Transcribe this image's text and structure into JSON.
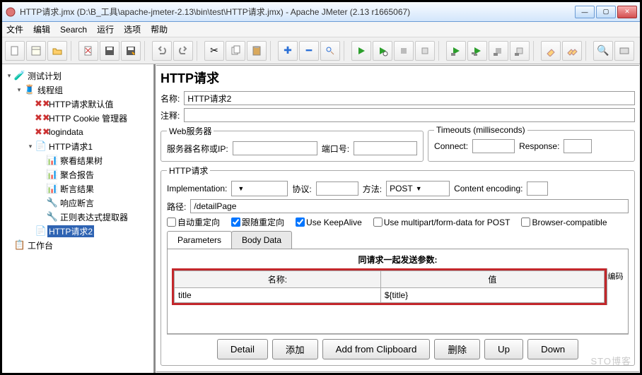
{
  "window": {
    "title": "HTTP请求.jmx (D:\\B_工具\\apache-jmeter-2.13\\bin\\test\\HTTP请求.jmx) - Apache JMeter (2.13 r1665067)"
  },
  "menu": {
    "file": "文件",
    "edit": "编辑",
    "search": "Search",
    "run": "运行",
    "options": "选项",
    "help": "帮助"
  },
  "tree": {
    "root": "测试计划",
    "threadgroup": "线程组",
    "httpdefault": "HTTP请求默认值",
    "cookie": "HTTP Cookie 管理器",
    "logindata": "logindata",
    "req1": "HTTP请求1",
    "restree": "察看结果树",
    "aggrep": "聚合报告",
    "assertres": "断言结果",
    "respassert": "响应断言",
    "regex": "正则表达式提取器",
    "req2": "HTTP请求2",
    "workbench": "工作台"
  },
  "editor": {
    "heading": "HTTP请求",
    "name_label": "名称:",
    "name_value": "HTTP请求2",
    "comment_label": "注释:",
    "webserver_legend": "Web服务器",
    "server_label": "服务器名称或IP:",
    "port_label": "端口号:",
    "timeouts_legend": "Timeouts (milliseconds)",
    "connect_label": "Connect:",
    "response_label": "Response:",
    "httpreq_legend": "HTTP请求",
    "impl_label": "Implementation:",
    "protocol_label": "协议:",
    "method_label": "方法:",
    "method_value": "POST",
    "encoding_label": "Content encoding:",
    "path_label": "路径:",
    "path_value": "/detailPage",
    "chk_autoredir": "自动重定向",
    "chk_followredir": "跟随重定向",
    "chk_keepalive": "Use KeepAlive",
    "chk_multipart": "Use multipart/form-data for POST",
    "chk_browser": "Browser-compatible",
    "tab_params": "Parameters",
    "tab_body": "Body Data",
    "params_title": "同请求一起发送参数:",
    "col_name": "名称:",
    "col_value": "值",
    "col_encode": "编码",
    "param_name": "title",
    "param_value": "${title}",
    "btn_detail": "Detail",
    "btn_add": "添加",
    "btn_clip": "Add from Clipboard",
    "btn_delete": "删除",
    "btn_up": "Up",
    "btn_down": "Down"
  },
  "watermark": "STO博客"
}
